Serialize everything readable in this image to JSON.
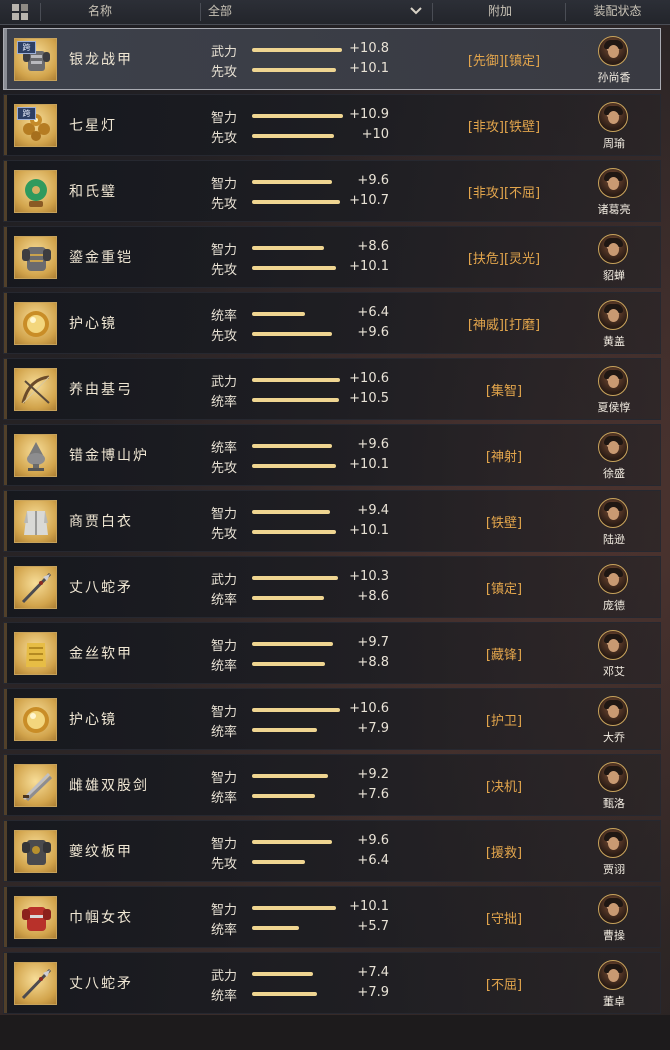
{
  "header": {
    "name_col": "名称",
    "filter_value": "全部",
    "bonus_col": "附加",
    "equip_col": "装配状态"
  },
  "colors": {
    "bar_fill": "#efd591",
    "tag_text": "#e2a54c",
    "icon_gold": "#d2a44c",
    "selected_border": "#a9abb2"
  },
  "items": [
    {
      "name": "银龙战甲",
      "icon": "armor-icon",
      "cross_badge": "跨",
      "selected": true,
      "stats": [
        {
          "label": "武力",
          "value": "+10.8",
          "fill": 0.97
        },
        {
          "label": "先攻",
          "value": "+10.1",
          "fill": 0.9
        }
      ],
      "tags": "[先御][镇定]",
      "general": "孙尚香"
    },
    {
      "name": "七星灯",
      "icon": "lamp-icon",
      "cross_badge": "跨",
      "selected": false,
      "stats": [
        {
          "label": "智力",
          "value": "+10.9",
          "fill": 0.98
        },
        {
          "label": "先攻",
          "value": "+10",
          "fill": 0.88
        }
      ],
      "tags": "[非攻][铁壁]",
      "general": "周瑜"
    },
    {
      "name": "和氏璧",
      "icon": "jade-disc-icon",
      "cross_badge": "",
      "selected": false,
      "stats": [
        {
          "label": "智力",
          "value": "+9.6",
          "fill": 0.86
        },
        {
          "label": "先攻",
          "value": "+10.7",
          "fill": 0.95
        }
      ],
      "tags": "[非攻][不屈]",
      "general": "诸葛亮"
    },
    {
      "name": "鎏金重铠",
      "icon": "heavy-armor-icon",
      "cross_badge": "",
      "selected": false,
      "stats": [
        {
          "label": "智力",
          "value": "+8.6",
          "fill": 0.77
        },
        {
          "label": "先攻",
          "value": "+10.1",
          "fill": 0.9
        }
      ],
      "tags": "[扶危][灵光]",
      "general": "貂蝉"
    },
    {
      "name": "护心镜",
      "icon": "mirror-icon",
      "cross_badge": "",
      "selected": false,
      "stats": [
        {
          "label": "统率",
          "value": "+6.4",
          "fill": 0.57
        },
        {
          "label": "先攻",
          "value": "+9.6",
          "fill": 0.86
        }
      ],
      "tags": "[神威][打磨]",
      "general": "黄盖"
    },
    {
      "name": "养由基弓",
      "icon": "bow-icon",
      "cross_badge": "",
      "selected": false,
      "stats": [
        {
          "label": "武力",
          "value": "+10.6",
          "fill": 0.95
        },
        {
          "label": "统率",
          "value": "+10.5",
          "fill": 0.94
        }
      ],
      "tags": "[集智]",
      "general": "夏侯惇"
    },
    {
      "name": "错金博山炉",
      "icon": "censer-icon",
      "cross_badge": "",
      "selected": false,
      "stats": [
        {
          "label": "统率",
          "value": "+9.6",
          "fill": 0.86
        },
        {
          "label": "先攻",
          "value": "+10.1",
          "fill": 0.9
        }
      ],
      "tags": "[神射]",
      "general": "徐盛"
    },
    {
      "name": "商贾白衣",
      "icon": "robe-icon",
      "cross_badge": "",
      "selected": false,
      "stats": [
        {
          "label": "智力",
          "value": "+9.4",
          "fill": 0.84
        },
        {
          "label": "先攻",
          "value": "+10.1",
          "fill": 0.9
        }
      ],
      "tags": "[铁壁]",
      "general": "陆逊"
    },
    {
      "name": "丈八蛇矛",
      "icon": "spear-icon",
      "cross_badge": "",
      "selected": false,
      "stats": [
        {
          "label": "武力",
          "value": "+10.3",
          "fill": 0.92
        },
        {
          "label": "统率",
          "value": "+8.6",
          "fill": 0.77
        }
      ],
      "tags": "[镇定]",
      "general": "庞德"
    },
    {
      "name": "金丝软甲",
      "icon": "golden-vest-icon",
      "cross_badge": "",
      "selected": false,
      "stats": [
        {
          "label": "智力",
          "value": "+9.7",
          "fill": 0.87
        },
        {
          "label": "统率",
          "value": "+8.8",
          "fill": 0.79
        }
      ],
      "tags": "[藏锋]",
      "general": "邓艾"
    },
    {
      "name": "护心镜",
      "icon": "mirror-icon",
      "cross_badge": "",
      "selected": false,
      "stats": [
        {
          "label": "智力",
          "value": "+10.6",
          "fill": 0.95
        },
        {
          "label": "统率",
          "value": "+7.9",
          "fill": 0.7
        }
      ],
      "tags": "[护卫]",
      "general": "大乔"
    },
    {
      "name": "雌雄双股剑",
      "icon": "twin-swords-icon",
      "cross_badge": "",
      "selected": false,
      "stats": [
        {
          "label": "智力",
          "value": "+9.2",
          "fill": 0.82
        },
        {
          "label": "统率",
          "value": "+7.6",
          "fill": 0.68
        }
      ],
      "tags": "[决机]",
      "general": "甄洛"
    },
    {
      "name": "夔纹板甲",
      "icon": "plate-armor-icon",
      "cross_badge": "",
      "selected": false,
      "stats": [
        {
          "label": "智力",
          "value": "+9.6",
          "fill": 0.86
        },
        {
          "label": "先攻",
          "value": "+6.4",
          "fill": 0.57
        }
      ],
      "tags": "[援救]",
      "general": "贾诩"
    },
    {
      "name": "巾帼女衣",
      "icon": "red-armor-icon",
      "cross_badge": "",
      "selected": false,
      "stats": [
        {
          "label": "智力",
          "value": "+10.1",
          "fill": 0.9
        },
        {
          "label": "统率",
          "value": "+5.7",
          "fill": 0.51
        }
      ],
      "tags": "[守拙]",
      "general": "曹操"
    },
    {
      "name": "丈八蛇矛",
      "icon": "spear-icon",
      "cross_badge": "",
      "selected": false,
      "stats": [
        {
          "label": "武力",
          "value": "+7.4",
          "fill": 0.66
        },
        {
          "label": "统率",
          "value": "+7.9",
          "fill": 0.7
        }
      ],
      "tags": "[不屈]",
      "general": "董卓"
    }
  ]
}
